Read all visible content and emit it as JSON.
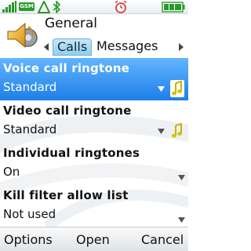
{
  "status": {
    "network_badge": "GSM",
    "icons": [
      "signal-icon",
      "gsm-icon",
      "warning-triangle-icon",
      "bluetooth-icon",
      "alarm-icon",
      "battery-icon"
    ]
  },
  "header": {
    "title": "General",
    "tabs": [
      {
        "label": "Calls",
        "active": true
      },
      {
        "label": "Messages",
        "active": false
      }
    ]
  },
  "settings": [
    {
      "label": "Voice call ringtone",
      "value": "Standard",
      "selected": true,
      "has_note_icon": true
    },
    {
      "label": "Video call ringtone",
      "value": "Standard",
      "selected": false,
      "has_note_icon": true
    },
    {
      "label": "Individual ringtones",
      "value": "On",
      "selected": false,
      "has_note_icon": false
    },
    {
      "label": "Kill filter allow list",
      "value": "Not used",
      "selected": false,
      "has_note_icon": false
    }
  ],
  "softkeys": {
    "left": "Options",
    "center": "Open",
    "right": "Cancel"
  },
  "colors": {
    "selection_top": "#63b5ff",
    "selection_bottom": "#1d7fe8",
    "tab_active": "#8fd0ee",
    "gsm_badge": "#2a9a2a"
  }
}
